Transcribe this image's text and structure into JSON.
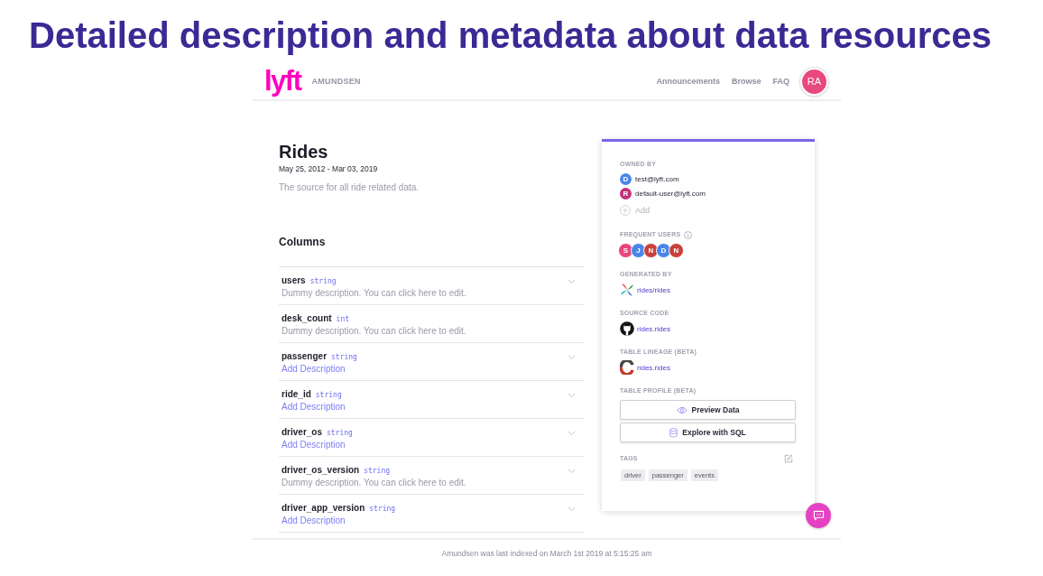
{
  "slide_title": "Detailed description and metadata about data resources",
  "header": {
    "logo": "lyft",
    "brand": "AMUNDSEN",
    "nav": [
      "Announcements",
      "Browse",
      "FAQ"
    ],
    "avatar": "RA"
  },
  "table": {
    "name": "Rides",
    "date_range": "May 25, 2012 - Mar 03, 2019",
    "description": "The source for all ride related data."
  },
  "columns_heading": "Columns",
  "columns": [
    {
      "name": "users",
      "type": "string",
      "kind": "text",
      "description": "Dummy description. You can click here to edit.",
      "expandable": true
    },
    {
      "name": "desk_count",
      "type": "int",
      "kind": "text",
      "description": "Dummy description. You can click here to edit.",
      "expandable": false
    },
    {
      "name": "passenger",
      "type": "string",
      "kind": "link",
      "description": "Add Description",
      "expandable": true
    },
    {
      "name": "ride_id",
      "type": "string",
      "kind": "link",
      "description": "Add Description",
      "expandable": true
    },
    {
      "name": "driver_os",
      "type": "string",
      "kind": "link",
      "description": "Add Description",
      "expandable": true
    },
    {
      "name": "driver_os_version",
      "type": "string",
      "kind": "text",
      "description": "Dummy description. You can click here to edit.",
      "expandable": true
    },
    {
      "name": "driver_app_version",
      "type": "string",
      "kind": "link",
      "description": "Add Description",
      "expandable": true
    }
  ],
  "panel": {
    "owned_by": {
      "label": "OWNED BY",
      "owners": [
        {
          "initial": "D",
          "email": "test@lyft.com",
          "color": "#4a86e8"
        },
        {
          "initial": "R",
          "email": "default-user@lyft.com",
          "color": "#c2307a"
        }
      ],
      "add": "Add"
    },
    "frequent_users": {
      "label": "FREQUENT USERS",
      "users": [
        {
          "initial": "S",
          "color": "#e8457c"
        },
        {
          "initial": "J",
          "color": "#4a86e8"
        },
        {
          "initial": "N",
          "color": "#c9413a"
        },
        {
          "initial": "D",
          "color": "#4a86e8"
        },
        {
          "initial": "N",
          "color": "#c9413a"
        }
      ]
    },
    "generated_by": {
      "label": "GENERATED BY",
      "link": "rides/rides"
    },
    "source_code": {
      "label": "SOURCE CODE",
      "link": "rides.rides"
    },
    "table_lineage": {
      "label": "TABLE LINEAGE (BETA)",
      "link": "rides.rides"
    },
    "table_profile": {
      "label": "TABLE PROFILE (BETA)",
      "buttons": [
        {
          "label": "Preview Data",
          "kind": "preview"
        },
        {
          "label": "Explore with SQL",
          "kind": "sql"
        }
      ]
    },
    "tags": {
      "label": "TAGS",
      "items": [
        "driver",
        "passenger",
        "events"
      ]
    }
  },
  "footer": "Amundsen was last indexed on March 1st 2019 at 5:15:25 am"
}
